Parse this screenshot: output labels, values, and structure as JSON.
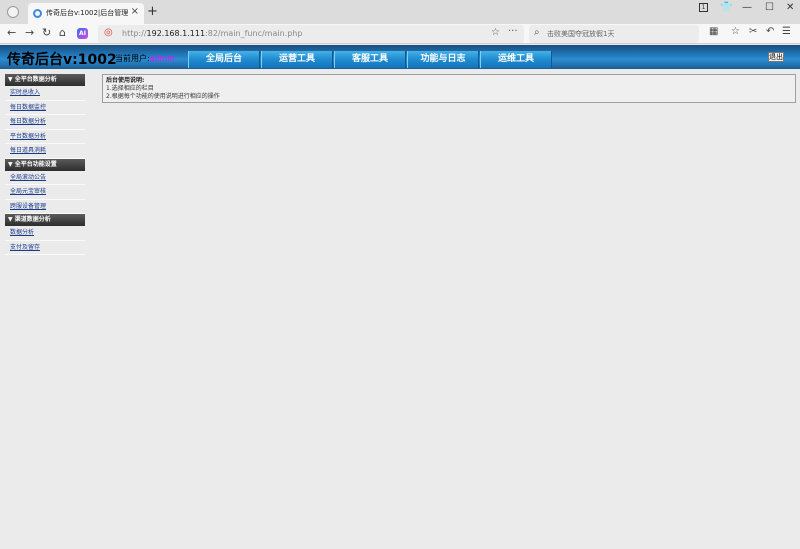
{
  "browser": {
    "tab_title": "传奇后台v:1002|后台管理",
    "tab_close": "×",
    "new_tab": "+",
    "url_prefix": "http://",
    "url_host": "192.168.1.111",
    "url_path": ":82/main_func/main.php",
    "search_placeholder": "击败美国夺冠放假1天",
    "ai_label": "AI",
    "badge_count": "1"
  },
  "header": {
    "brand": "传奇后台v:1002",
    "user_label": "当前用户:",
    "user_name": "admin",
    "logout_label": "退出"
  },
  "main_nav": [
    {
      "label": "全局后台"
    },
    {
      "label": "运营工具"
    },
    {
      "label": "客服工具"
    },
    {
      "label": "功能与日志"
    },
    {
      "label": "运维工具"
    }
  ],
  "sidebar": {
    "sections": [
      {
        "title": "▼ 全平台数据分析",
        "items": [
          "实时总收入",
          "每日数据监控",
          "每日数据分析",
          "平台数据分析",
          "每日道具消耗"
        ]
      },
      {
        "title": "▼ 全平台功能设置",
        "items": [
          "全局滚动公告",
          "全局元宝审核",
          "跨服设备管理"
        ]
      },
      {
        "title": "▼ 渠道数据分析",
        "items": [
          "数据分析",
          "支付及留存"
        ]
      }
    ]
  },
  "notice": {
    "title": "后台使用说明:",
    "line1": "1.选择相应的栏目",
    "line2": "2.根据每个功能的使用说明进行相应的操作"
  }
}
